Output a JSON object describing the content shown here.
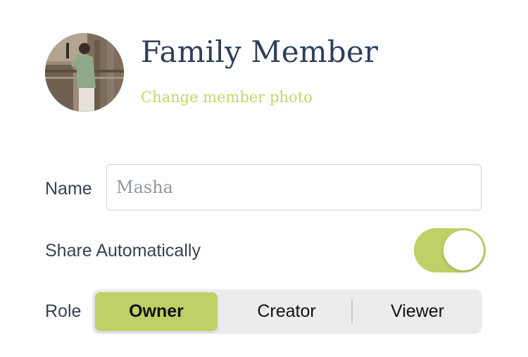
{
  "header": {
    "title": "Family Member",
    "change_photo_label": "Change member photo"
  },
  "form": {
    "name_label": "Name",
    "name_value": "",
    "name_placeholder": "Masha",
    "share_label": "Share Automatically",
    "share_enabled": true,
    "role_label": "Role",
    "roles": [
      "Owner",
      "Creator",
      "Viewer"
    ],
    "selected_role": "Owner"
  },
  "colors": {
    "accent": "#bfd066",
    "title": "#2f3e5a",
    "link": "#c3d56c",
    "segment_bg": "#ececee"
  }
}
